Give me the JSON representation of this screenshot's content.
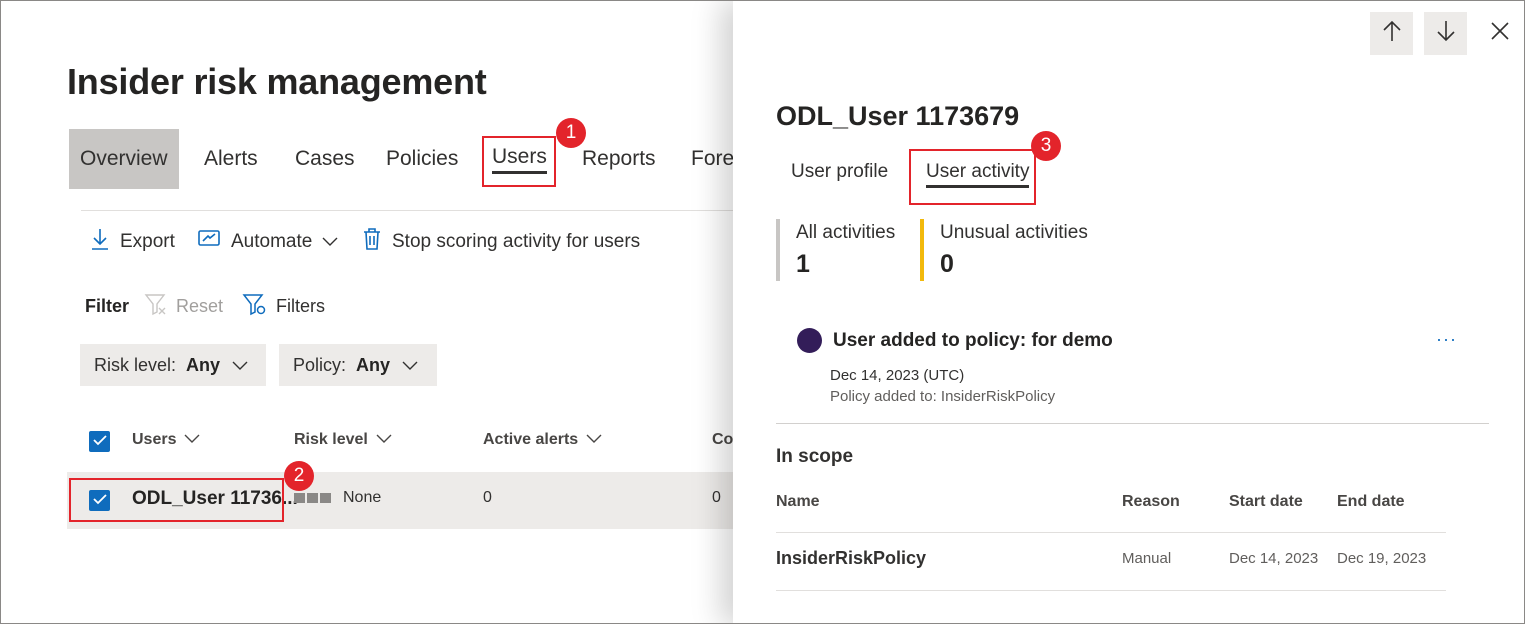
{
  "page": {
    "title": "Insider risk management",
    "tabs": [
      {
        "label": "Overview"
      },
      {
        "label": "Alerts"
      },
      {
        "label": "Cases"
      },
      {
        "label": "Policies"
      },
      {
        "label": "Users"
      },
      {
        "label": "Reports"
      },
      {
        "label": "Fore"
      }
    ],
    "commands": {
      "export": "Export",
      "automate": "Automate",
      "stop_scoring": "Stop scoring activity for users"
    },
    "filter": {
      "label": "Filter",
      "reset": "Reset",
      "filters": "Filters",
      "risk_level_label": "Risk level:",
      "risk_level_value": "Any",
      "policy_label": "Policy:",
      "policy_value": "Any"
    },
    "table": {
      "headers": [
        "Users",
        "Risk level",
        "Active alerts",
        "Co"
      ],
      "rows": [
        {
          "user": "ODL_User 11736...",
          "risk_level": "None",
          "active_alerts": "0",
          "co": "0"
        }
      ]
    }
  },
  "callouts": [
    "1",
    "2",
    "3"
  ],
  "panel": {
    "user_name": "ODL_User 1173679",
    "tabs": [
      {
        "label": "User profile"
      },
      {
        "label": "User activity"
      }
    ],
    "stats": [
      {
        "label": "All activities",
        "value": "1",
        "color": "#c8c6c4"
      },
      {
        "label": "Unusual activities",
        "value": "0",
        "color": "#f2b90c"
      }
    ],
    "activity": {
      "title": "User added to policy: for demo",
      "date": "Dec 14, 2023 (UTC)",
      "description": "Policy added to: InsiderRiskPolicy",
      "more": "···",
      "dot_color": "#331d59"
    },
    "scope": {
      "title": "In scope",
      "headers": [
        "Name",
        "Reason",
        "Start date",
        "End date"
      ],
      "rows": [
        {
          "name": "InsiderRiskPolicy",
          "reason": "Manual",
          "start": "Dec 14, 2023",
          "end": "Dec 19, 2023"
        }
      ]
    }
  },
  "colors": {
    "accent": "#0f6cbd",
    "callout": "#e3242b"
  }
}
